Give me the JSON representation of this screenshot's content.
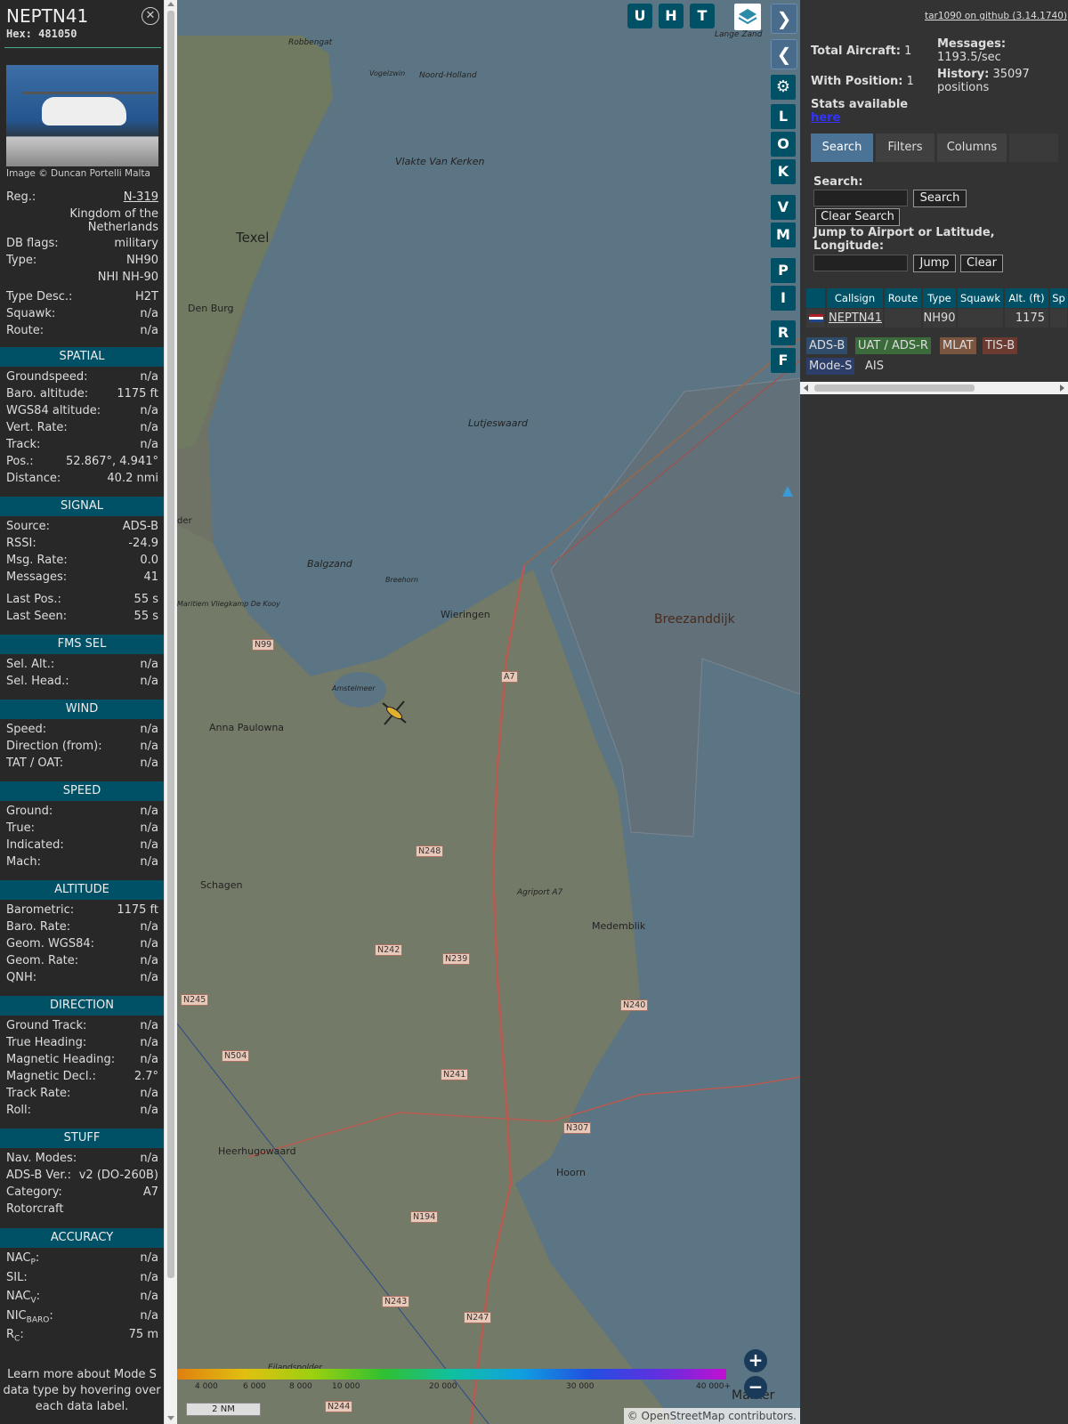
{
  "aircraft": {
    "callsign": "NEPTN41",
    "hex_label": "Hex:",
    "hex": "481050",
    "image_credit": "Image © Duncan Portelli Malta",
    "reg_label": "Reg.:",
    "reg": "N-319",
    "country_line1": "Kingdom of the",
    "country_line2": "Netherlands",
    "db_flags_label": "DB flags:",
    "db_flags": "military",
    "type_label": "Type:",
    "type": "NH90",
    "type_full": "NHI NH-90",
    "type_desc_label": "Type Desc.:",
    "type_desc": "H2T",
    "squawk_label": "Squawk:",
    "squawk": "n/a",
    "route_label": "Route:",
    "route": "n/a"
  },
  "sections": {
    "spatial": "SPATIAL",
    "signal": "SIGNAL",
    "fms": "FMS SEL",
    "wind": "WIND",
    "speed": "SPEED",
    "altitude": "ALTITUDE",
    "direction": "DIRECTION",
    "stuff": "STUFF",
    "accuracy": "ACCURACY"
  },
  "spatial": [
    {
      "k": "Groundspeed:",
      "v": "n/a"
    },
    {
      "k": "Baro. altitude:",
      "v": "1175 ft"
    },
    {
      "k": "WGS84 altitude:",
      "v": "n/a"
    },
    {
      "k": "Vert. Rate:",
      "v": "n/a"
    },
    {
      "k": "Track:",
      "v": "n/a"
    },
    {
      "k": "Pos.:",
      "v": "52.867°, 4.941°"
    },
    {
      "k": "Distance:",
      "v": "40.2 nmi"
    }
  ],
  "signal": [
    {
      "k": "Source:",
      "v": "ADS-B"
    },
    {
      "k": "RSSI:",
      "v": "-24.9"
    },
    {
      "k": "Msg. Rate:",
      "v": "0.0"
    },
    {
      "k": "Messages:",
      "v": "41"
    },
    {
      "k": "Last Pos.:",
      "v": "55 s"
    },
    {
      "k": "Last Seen:",
      "v": "55 s"
    }
  ],
  "fms": [
    {
      "k": "Sel. Alt.:",
      "v": "n/a"
    },
    {
      "k": "Sel. Head.:",
      "v": "n/a"
    }
  ],
  "wind": [
    {
      "k": "Speed:",
      "v": "n/a"
    },
    {
      "k": "Direction (from):",
      "v": "n/a"
    },
    {
      "k": "TAT / OAT:",
      "v": "n/a"
    }
  ],
  "speed": [
    {
      "k": "Ground:",
      "v": "n/a"
    },
    {
      "k": "True:",
      "v": "n/a"
    },
    {
      "k": "Indicated:",
      "v": "n/a"
    },
    {
      "k": "Mach:",
      "v": "n/a"
    }
  ],
  "altitude": [
    {
      "k": "Barometric:",
      "v": "1175 ft"
    },
    {
      "k": "Baro. Rate:",
      "v": "n/a"
    },
    {
      "k": "Geom. WGS84:",
      "v": "n/a"
    },
    {
      "k": "Geom. Rate:",
      "v": "n/a"
    },
    {
      "k": "QNH:",
      "v": "n/a"
    }
  ],
  "direction": [
    {
      "k": "Ground Track:",
      "v": "n/a"
    },
    {
      "k": "True Heading:",
      "v": "n/a"
    },
    {
      "k": "Magnetic Heading:",
      "v": "n/a"
    },
    {
      "k": "Magnetic Decl.:",
      "v": "2.7°"
    },
    {
      "k": "Track Rate:",
      "v": "n/a"
    },
    {
      "k": "Roll:",
      "v": "n/a"
    }
  ],
  "stuff": [
    {
      "k": "Nav. Modes:",
      "v": "n/a"
    },
    {
      "k": "ADS-B Ver.:",
      "v": "v2 (DO-260B)"
    },
    {
      "k": "Category:",
      "v": "A7"
    },
    {
      "k": "Rotorcraft",
      "v": ""
    }
  ],
  "accuracy": [
    {
      "k": "NAC",
      "sub": "P",
      "tail": ":",
      "v": "n/a"
    },
    {
      "k": "SIL:",
      "sub": "",
      "tail": "",
      "v": "n/a"
    },
    {
      "k": "NAC",
      "sub": "V",
      "tail": ":",
      "v": "n/a"
    },
    {
      "k": "NIC",
      "sub": "BARO",
      "tail": ":",
      "v": "n/a"
    },
    {
      "k": "R",
      "sub": "C",
      "tail": ":",
      "v": "75 m"
    }
  ],
  "learn_more": "Learn more about Mode S data type by hovering over each data label.",
  "map": {
    "place_labels": [
      "Texel",
      "Den Burg",
      "Robbengat",
      "Vlakte Van Kerken",
      "Lutjeswaard",
      "Balgzand",
      "Wieringen",
      "Breezanddijk",
      "Anna Paulowna",
      "Schagen",
      "Medemblik",
      "Heerhugowaard",
      "Hoorn",
      "Eilandspolder",
      "Amstelmeer",
      "Agriport A7",
      "Vogelzwin",
      "Noord-Holland",
      "Breehorn",
      "Maritiem Vliegkamp De Kooy",
      "Lange Zand",
      "der",
      "Marker"
    ],
    "road_labels": [
      "N99",
      "A7",
      "N248",
      "N242",
      "N239",
      "N245",
      "N240",
      "N504",
      "N241",
      "N307",
      "N194",
      "N243",
      "N247",
      "N244"
    ],
    "layer_buttons": [
      "U",
      "H",
      "T"
    ],
    "side_buttons": [
      "L",
      "O",
      "K",
      "V",
      "M",
      "P",
      "I",
      "R",
      "F"
    ],
    "scale": {
      "labels": [
        "4 000",
        "6 000",
        "8 000",
        "10 000",
        "20 000",
        "30 000",
        "40 000+"
      ],
      "distance": "2 NM"
    },
    "attribution": "© OpenStreetMap contributors.",
    "zoom_in": "+",
    "zoom_out": "−"
  },
  "panel": {
    "github_link": "tar1090 on github (3.14.1740)",
    "total_aircraft_label": "Total Aircraft:",
    "total_aircraft": "1",
    "messages_label": "Messages:",
    "messages": "1193.5/sec",
    "with_position_label": "With Position:",
    "with_position": "1",
    "history_label": "History:",
    "history": "35097",
    "history_unit": "positions",
    "stats_label": "Stats available",
    "stats_link": "here",
    "tabs": [
      "Search",
      "Filters",
      "Columns"
    ],
    "search_label": "Search:",
    "search_button": "Search",
    "clear_search_button": "Clear Search",
    "jump_label": "Jump to Airport or Latitude, Longitude:",
    "jump_button": "Jump",
    "clear_button": "Clear",
    "table_headers": [
      "Callsign",
      "Route",
      "Type",
      "Squawk",
      "Alt. (ft)",
      "Sp"
    ],
    "table_row": {
      "callsign": "NEPTN41",
      "route": "",
      "type": "NH90",
      "squawk": "",
      "alt": "1175"
    },
    "sources": [
      "ADS-B",
      "UAT / ADS-R",
      "MLAT",
      "TIS-B",
      "Mode-S",
      "AIS"
    ]
  },
  "colors": {
    "accent": "#005066",
    "sidebar_bg": "#282828",
    "adsb": "#304c6b",
    "uat": "#3b6b3b",
    "mlat": "#7a5540",
    "tisb": "#6b3a30",
    "modes": "#2e3e6b"
  }
}
